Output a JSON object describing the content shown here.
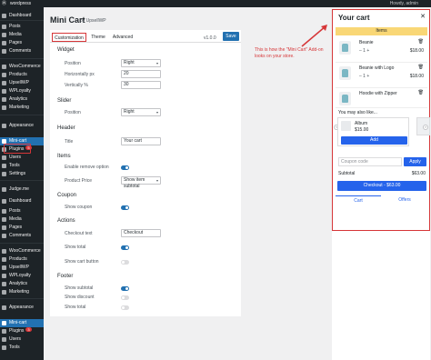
{
  "adminbar": {
    "site": "wordpress",
    "howdy": "Howdy, admin"
  },
  "sidebar": {
    "top": [
      {
        "label": "Dashboard",
        "icon": "dashboard-icon"
      },
      {
        "label": "Posts",
        "icon": "pin-icon"
      },
      {
        "label": "Media",
        "icon": "media-icon"
      },
      {
        "label": "Pages",
        "icon": "page-icon"
      },
      {
        "label": "Comments",
        "icon": "comment-icon"
      },
      {
        "label": "WooCommerce",
        "icon": "woo-icon"
      },
      {
        "label": "Products",
        "icon": "product-icon"
      },
      {
        "label": "UpsellWP",
        "icon": "upsell-icon"
      },
      {
        "label": "WPLoyalty",
        "icon": "loyalty-icon"
      },
      {
        "label": "Analytics",
        "icon": "chart-icon"
      },
      {
        "label": "Marketing",
        "icon": "megaphone-icon"
      },
      {
        "label": "Appearance",
        "icon": "brush-icon"
      },
      {
        "label": "Mini-cart",
        "icon": "cart-icon",
        "active": true
      },
      {
        "label": "Plugins",
        "icon": "plugin-icon",
        "badge": "5"
      },
      {
        "label": "Users",
        "icon": "user-icon"
      },
      {
        "label": "Tools",
        "icon": "tool-icon"
      },
      {
        "label": "Settings",
        "icon": "settings-icon"
      },
      {
        "label": "Judge.me",
        "icon": "star-icon"
      }
    ],
    "bottom": [
      {
        "label": "Dashboard",
        "icon": "dashboard-icon"
      },
      {
        "label": "Posts",
        "icon": "pin-icon"
      },
      {
        "label": "Media",
        "icon": "media-icon"
      },
      {
        "label": "Pages",
        "icon": "page-icon"
      },
      {
        "label": "Comments",
        "icon": "comment-icon"
      },
      {
        "label": "WooCommerce",
        "icon": "woo-icon"
      },
      {
        "label": "Products",
        "icon": "product-icon"
      },
      {
        "label": "UpsellWP",
        "icon": "upsell-icon"
      },
      {
        "label": "WPLoyalty",
        "icon": "loyalty-icon"
      },
      {
        "label": "Analytics",
        "icon": "chart-icon"
      },
      {
        "label": "Marketing",
        "icon": "megaphone-icon"
      },
      {
        "label": "Appearance",
        "icon": "brush-icon"
      },
      {
        "label": "Mini-cart",
        "icon": "cart-icon",
        "active": true
      },
      {
        "label": "Plugins",
        "icon": "plugin-icon",
        "badge": "3"
      },
      {
        "label": "Users",
        "icon": "user-icon"
      },
      {
        "label": "Tools",
        "icon": "tool-icon"
      }
    ]
  },
  "page": {
    "title": "Mini Cart",
    "by": "by UpsellWP",
    "tabs": [
      "Customization",
      "Theme",
      "Advanced"
    ],
    "version": "v1.0.0",
    "save": "Save"
  },
  "settings": {
    "widget": {
      "heading": "Widget",
      "position_label": "Position",
      "position_value": "Right",
      "horizontally_label": "Horizontally px",
      "horizontally_value": "20",
      "vertically_label": "Vertically %",
      "vertically_value": "30"
    },
    "slider": {
      "heading": "Slider",
      "position_label": "Position",
      "position_value": "Right"
    },
    "header": {
      "heading": "Header",
      "title_label": "Title",
      "title_value": "Your cart"
    },
    "items": {
      "heading": "Items",
      "remove_label": "Enable remove option",
      "remove_on": true,
      "price_label": "Product Price",
      "price_value": "Show item subtotal"
    },
    "coupon": {
      "heading": "Coupon",
      "show_label": "Show coupon",
      "show_on": true
    },
    "actions": {
      "heading": "Actions",
      "checkout_label": "Checkout text",
      "checkout_value": "Checkout",
      "total_label": "Show total",
      "total_on": true,
      "cart_label": "Show cart button",
      "cart_on": false
    },
    "footer": {
      "heading": "Footer",
      "subtotal_label": "Show subtotal",
      "subtotal_on": true,
      "discount_label": "Show discount",
      "discount_on": false,
      "total_label": "Show total",
      "total_on": false
    }
  },
  "annotation": "This is how the \"Mini Cart\" Add-on looks on your store.",
  "cart": {
    "title": "Your cart",
    "items_label": "Items",
    "items": [
      {
        "name": "Beanie",
        "qty": "1",
        "price": "$18.00"
      },
      {
        "name": "Beanie with Logo",
        "qty": "1",
        "price": "$18.00"
      },
      {
        "name": "Hoodie with Zipper",
        "qty": "",
        "price": ""
      }
    ],
    "may_like": "You may also like...",
    "upsell": {
      "name": "Album",
      "price": "$15.00",
      "button": "Add"
    },
    "coupon_placeholder": "Coupon code",
    "apply": "Apply",
    "subtotal_label": "Subtotal",
    "subtotal_value": "$63.00",
    "checkout": "Checkout - $63.00",
    "tab_cart": "Cart",
    "tab_offers": "Offers"
  },
  "colors": {
    "accent": "#2271b1",
    "cart_blue": "#2563eb",
    "highlight_red": "#d63638",
    "items_yellow": "#f9d776",
    "sidebar": "#1d2327"
  }
}
